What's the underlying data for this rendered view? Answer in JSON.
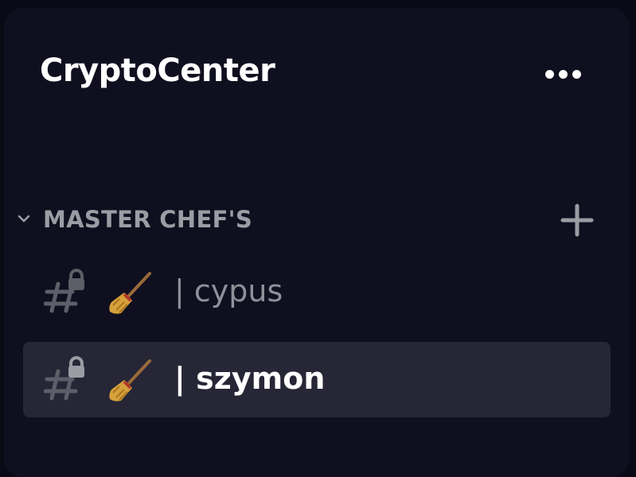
{
  "server": {
    "title": "CryptoCenter",
    "menu_icon": "more-horizontal-icon"
  },
  "category": {
    "label": "MASTER CHEF'S",
    "collapse_icon": "chevron-down-icon",
    "add_icon": "plus-icon"
  },
  "channels": [
    {
      "name": "| cypus",
      "icon": "locked-hashtag-icon",
      "emoji": "broom-emoji",
      "selected": false
    },
    {
      "name": "| szymon",
      "icon": "locked-hashtag-icon",
      "emoji": "broom-emoji",
      "selected": true
    }
  ],
  "colors": {
    "background": "#0a0a17",
    "panel": "#0f0f1f",
    "selected_row": "#262636",
    "muted_text": "#8f909a",
    "header_text": "#9b9ca4",
    "white": "#ffffff"
  }
}
